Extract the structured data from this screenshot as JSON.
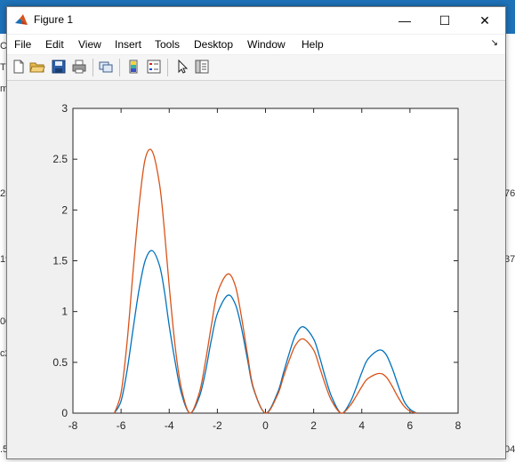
{
  "window": {
    "title": "Figure 1",
    "minimize_glyph": "—",
    "maximize_glyph": "☐",
    "close_glyph": "✕"
  },
  "menu": {
    "items": [
      {
        "label": "File"
      },
      {
        "label": "Edit"
      },
      {
        "label": "View"
      },
      {
        "label": "Insert"
      },
      {
        "label": "Tools"
      },
      {
        "label": "Desktop"
      },
      {
        "label": "Window"
      },
      {
        "label": "Help"
      }
    ],
    "dock_glyph": "↘"
  },
  "toolbar": {
    "tools": [
      "new-figure-icon",
      "open-file-icon",
      "save-icon",
      "print-icon",
      "link-plot-icon",
      "insert-colorbar-icon",
      "insert-legend-icon",
      "edit-plot-icon",
      "property-inspector-icon"
    ]
  },
  "background_fragments": {
    "left": [
      "Co",
      "Ti",
      "m",
      "25",
      "19",
      "00",
      "c2",
      ".5"
    ],
    "right": [
      "76",
      "37",
      "04"
    ]
  },
  "chart_data": {
    "type": "line",
    "title": "",
    "xlabel": "",
    "ylabel": "",
    "xlim": [
      -8,
      8
    ],
    "ylim": [
      0,
      3
    ],
    "x_ticks": [
      -8,
      -6,
      -4,
      -2,
      0,
      2,
      4,
      6,
      8
    ],
    "x_tick_labels": [
      "-8",
      "-6",
      "-4",
      "-2",
      "0",
      "2",
      "4",
      "6",
      "8"
    ],
    "y_ticks": [
      0,
      0.5,
      1,
      1.5,
      2,
      2.5,
      3
    ],
    "y_tick_labels": [
      "0",
      "0.5",
      "1",
      "1.5",
      "2",
      "2.5",
      "3"
    ],
    "grid": false,
    "series": [
      {
        "color": "#0072bd",
        "x": [
          -6.28,
          -6.0,
          -5.75,
          -5.5,
          -5.25,
          -5.0,
          -4.71,
          -4.4,
          -4.2,
          -4.0,
          -3.75,
          -3.5,
          -3.14,
          -2.75,
          -2.5,
          -2.25,
          -2.0,
          -1.57,
          -1.25,
          -1.0,
          -0.75,
          -0.5,
          0.0,
          0.5,
          0.75,
          1.0,
          1.25,
          1.57,
          2.0,
          2.25,
          2.5,
          2.75,
          3.14,
          3.5,
          3.75,
          4.0,
          4.25,
          4.71,
          5.0,
          5.25,
          5.5,
          5.75,
          6.0,
          6.28
        ],
        "y": [
          0.0,
          0.12,
          0.42,
          0.83,
          1.22,
          1.5,
          1.6,
          1.45,
          1.2,
          0.86,
          0.5,
          0.2,
          0.0,
          0.16,
          0.4,
          0.72,
          0.98,
          1.16,
          1.07,
          0.84,
          0.53,
          0.24,
          0.0,
          0.2,
          0.4,
          0.6,
          0.77,
          0.85,
          0.73,
          0.55,
          0.34,
          0.16,
          0.0,
          0.1,
          0.24,
          0.4,
          0.53,
          0.62,
          0.58,
          0.45,
          0.28,
          0.12,
          0.04,
          0.0
        ]
      },
      {
        "color": "#d95319",
        "x": [
          -6.28,
          -6.0,
          -5.75,
          -5.5,
          -5.25,
          -5.0,
          -4.71,
          -4.4,
          -4.2,
          -4.0,
          -3.75,
          -3.5,
          -3.14,
          -2.75,
          -2.5,
          -2.25,
          -2.0,
          -1.57,
          -1.25,
          -1.0,
          -0.75,
          -0.5,
          0.0,
          0.5,
          0.75,
          1.0,
          1.25,
          1.57,
          2.0,
          2.25,
          2.5,
          2.75,
          3.14,
          3.5,
          3.75,
          4.0,
          4.25,
          4.71,
          5.0,
          5.25,
          5.5,
          5.75,
          6.0,
          6.28
        ],
        "y": [
          0.0,
          0.2,
          0.7,
          1.4,
          2.05,
          2.5,
          2.58,
          2.25,
          1.8,
          1.25,
          0.65,
          0.25,
          0.0,
          0.2,
          0.5,
          0.86,
          1.18,
          1.37,
          1.25,
          0.95,
          0.58,
          0.25,
          0.0,
          0.18,
          0.36,
          0.53,
          0.67,
          0.73,
          0.62,
          0.45,
          0.27,
          0.12,
          0.0,
          0.07,
          0.16,
          0.26,
          0.34,
          0.39,
          0.36,
          0.27,
          0.16,
          0.07,
          0.02,
          0.0
        ]
      }
    ]
  }
}
